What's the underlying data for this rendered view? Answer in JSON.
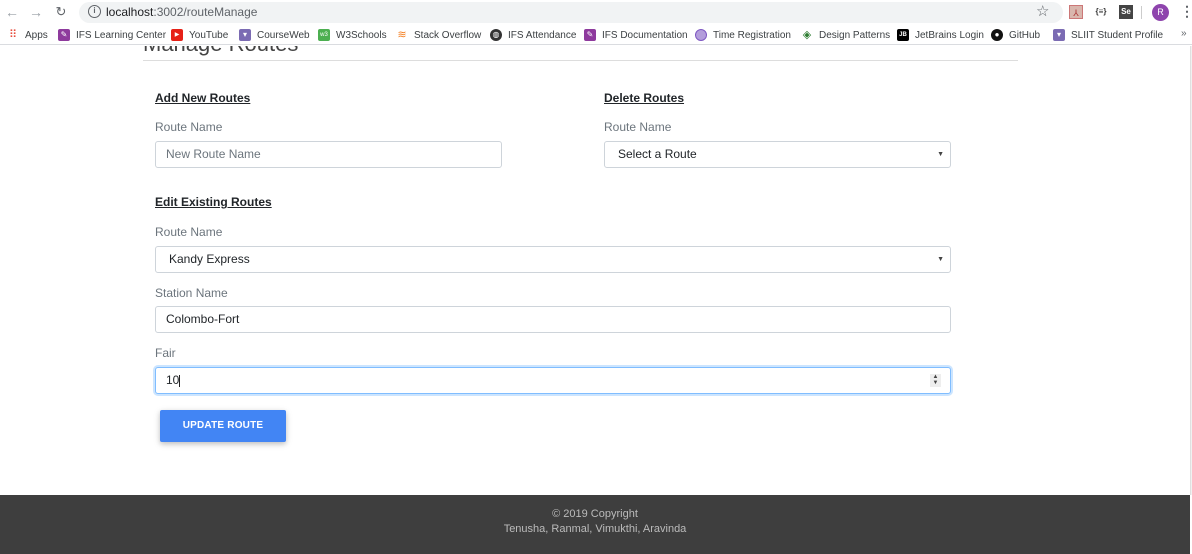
{
  "browser": {
    "url_host": "localhost",
    "url_path": ":3002/routeManage",
    "profile_initial": "R",
    "bookmarks": [
      {
        "label": "Apps",
        "icon": "apps-grid-icon"
      },
      {
        "label": "IFS Learning Center",
        "icon": "ifs-icon"
      },
      {
        "label": "YouTube",
        "icon": "youtube-icon"
      },
      {
        "label": "CourseWeb",
        "icon": "sliit-shield-icon"
      },
      {
        "label": "W3Schools",
        "icon": "w3schools-icon"
      },
      {
        "label": "Stack Overflow",
        "icon": "stackoverflow-icon"
      },
      {
        "label": "IFS Attendance",
        "icon": "globe-icon"
      },
      {
        "label": "IFS Documentation",
        "icon": "ifs-icon"
      },
      {
        "label": "Time Registration",
        "icon": "time-registration-icon"
      },
      {
        "label": "Design Patterns",
        "icon": "design-patterns-icon"
      },
      {
        "label": "JetBrains Login",
        "icon": "jetbrains-icon"
      },
      {
        "label": "GitHub",
        "icon": "github-icon"
      },
      {
        "label": "SLIIT Student Profile",
        "icon": "sliit-shield-icon"
      }
    ],
    "more_bookmarks": "»"
  },
  "page": {
    "title": "Manage Routes",
    "add_section": {
      "title": "Add New Routes",
      "route_label": "Route Name",
      "route_placeholder": "New Route Name"
    },
    "delete_section": {
      "title": "Delete Routes",
      "route_label": "Route Name",
      "route_selected": "Select a Route"
    },
    "edit_section": {
      "title": "Edit Existing Routes",
      "route_label": "Route Name",
      "route_selected": "Kandy Express",
      "station_label": "Station Name",
      "station_value": "Colombo-Fort",
      "fair_label": "Fair",
      "fair_value": "10",
      "update_button": "UPDATE ROUTE"
    }
  },
  "footer": {
    "copyright": "© 2019 Copyright",
    "authors": "Tenusha, Ranmal, Vimukthi, Aravinda"
  },
  "colors": {
    "primary_button": "#4285f4",
    "footer_bg": "#3e3e3e",
    "focus_border": "#80bdff"
  }
}
